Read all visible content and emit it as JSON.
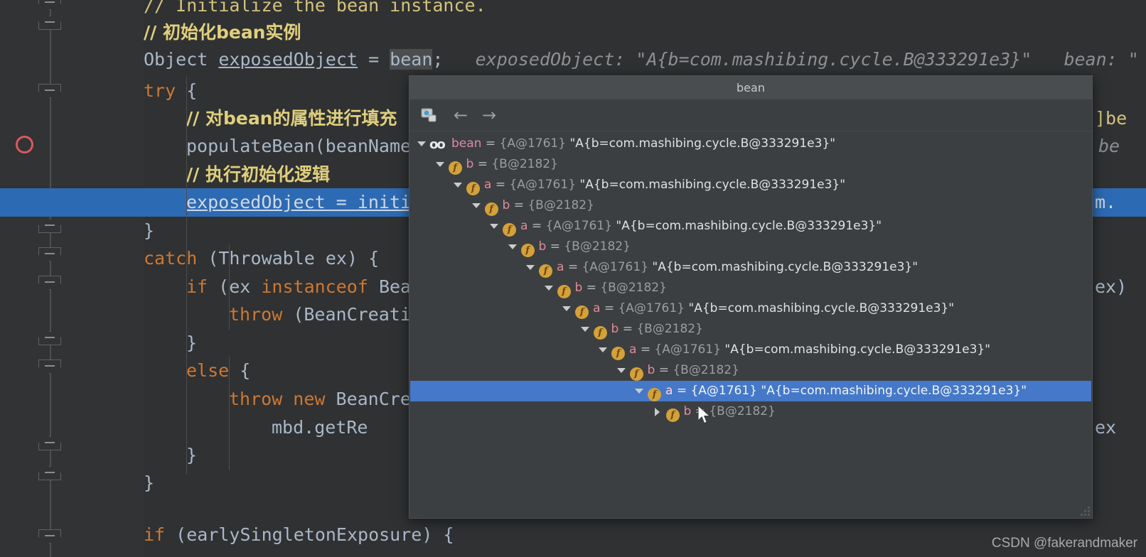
{
  "editor": {
    "lines": [
      {
        "indent": 0,
        "segments": [
          {
            "cls": "cm",
            "text": "// Initialize the bean instance."
          }
        ]
      },
      {
        "indent": 0,
        "segments": [
          {
            "cls": "cmcn",
            "text": "// 初始化bean实例"
          }
        ]
      },
      {
        "indent": 0,
        "segments": [
          {
            "cls": "pl",
            "text": "Object "
          },
          {
            "cls": "ident underl",
            "text": "exposedObject"
          },
          {
            "cls": "pl",
            "text": " = "
          },
          {
            "cls": "varhl",
            "text": "bean"
          },
          {
            "cls": "pl",
            "text": ";"
          },
          {
            "cls": "hintv",
            "text": "   exposedObject: \"A{b=com.mashibing.cycle.B@333291e3}\"   bean: \""
          }
        ]
      },
      {
        "indent": 0,
        "segments": [
          {
            "cls": "kw",
            "text": "try"
          },
          {
            "cls": "pl",
            "text": " {"
          }
        ]
      },
      {
        "indent": 1,
        "segments": [
          {
            "cls": "cmcn",
            "text": "// 对bean的属性进行填充"
          }
        ]
      },
      {
        "indent": 1,
        "segments": [
          {
            "cls": "pl",
            "text": "populateBean(beanName"
          }
        ]
      },
      {
        "indent": 1,
        "segments": [
          {
            "cls": "cmcn",
            "text": "// 执行初始化逻辑"
          }
        ]
      },
      {
        "indent": 0,
        "segments": [
          {
            "cls": "pl",
            "text": "}"
          }
        ]
      },
      {
        "indent": 0,
        "segments": [
          {
            "cls": "kw",
            "text": "catch"
          },
          {
            "cls": "pl",
            "text": " (Throwable ex) {"
          }
        ]
      },
      {
        "indent": 1,
        "segments": [
          {
            "cls": "kw",
            "text": "if"
          },
          {
            "cls": "pl",
            "text": " (ex "
          },
          {
            "cls": "kw",
            "text": "instanceof"
          },
          {
            "cls": "pl",
            "text": " Bea"
          }
        ]
      },
      {
        "indent": 2,
        "segments": [
          {
            "cls": "kw",
            "text": "throw"
          },
          {
            "cls": "pl",
            "text": " (BeanCreati"
          }
        ]
      },
      {
        "indent": 1,
        "segments": [
          {
            "cls": "pl",
            "text": "}"
          }
        ]
      },
      {
        "indent": 1,
        "segments": [
          {
            "cls": "kw",
            "text": "else"
          },
          {
            "cls": "pl",
            "text": " {"
          }
        ]
      },
      {
        "indent": 2,
        "segments": [
          {
            "cls": "kw",
            "text": "throw new"
          },
          {
            "cls": "pl",
            "text": " BeanCre"
          }
        ]
      },
      {
        "indent": 3,
        "segments": [
          {
            "cls": "pl",
            "text": "mbd.getRe"
          }
        ]
      },
      {
        "indent": 1,
        "segments": [
          {
            "cls": "pl",
            "text": "}"
          }
        ]
      },
      {
        "indent": 0,
        "segments": [
          {
            "cls": "pl",
            "text": "}"
          }
        ]
      },
      {
        "indent": 0,
        "segments": [
          {
            "cls": "kw",
            "text": "if"
          },
          {
            "cls": "pl",
            "text": " (earlySingletonExposure) {"
          }
        ]
      }
    ],
    "highlighted_line": "exposedObject = initi",
    "right_fragments": [
      {
        "text": "]be",
        "cls": "cm"
      },
      {
        "text": "be",
        "cls": "hintv"
      },
      {
        "text": "m.",
        "cls": "sel"
      },
      {
        "text": "ex)",
        "cls": "pl"
      },
      {
        "text": "ex",
        "cls": "pl"
      }
    ]
  },
  "popup": {
    "title": "bean",
    "toolbar": {
      "watch_icon": "copy-value-icon",
      "back_label": "←",
      "forward_label": "→"
    },
    "tree": [
      {
        "depth": 0,
        "icon": "watch",
        "arrow": "open",
        "selected": false,
        "name": "bean",
        "eq": " = ",
        "id": "{A@1761}",
        "value": "\"A{b=com.mashibing.cycle.B@333291e3}\""
      },
      {
        "depth": 1,
        "icon": "field",
        "arrow": "open",
        "selected": false,
        "name": "b",
        "eq": " = ",
        "id": "{B@2182}",
        "value": ""
      },
      {
        "depth": 2,
        "icon": "field",
        "arrow": "open",
        "selected": false,
        "name": "a",
        "eq": " = ",
        "id": "{A@1761}",
        "value": "\"A{b=com.mashibing.cycle.B@333291e3}\""
      },
      {
        "depth": 3,
        "icon": "field",
        "arrow": "open",
        "selected": false,
        "name": "b",
        "eq": " = ",
        "id": "{B@2182}",
        "value": ""
      },
      {
        "depth": 4,
        "icon": "field",
        "arrow": "open",
        "selected": false,
        "name": "a",
        "eq": " = ",
        "id": "{A@1761}",
        "value": "\"A{b=com.mashibing.cycle.B@333291e3}\""
      },
      {
        "depth": 5,
        "icon": "field",
        "arrow": "open",
        "selected": false,
        "name": "b",
        "eq": " = ",
        "id": "{B@2182}",
        "value": ""
      },
      {
        "depth": 6,
        "icon": "field",
        "arrow": "open",
        "selected": false,
        "name": "a",
        "eq": " = ",
        "id": "{A@1761}",
        "value": "\"A{b=com.mashibing.cycle.B@333291e3}\""
      },
      {
        "depth": 7,
        "icon": "field",
        "arrow": "open",
        "selected": false,
        "name": "b",
        "eq": " = ",
        "id": "{B@2182}",
        "value": ""
      },
      {
        "depth": 8,
        "icon": "field",
        "arrow": "open",
        "selected": false,
        "name": "a",
        "eq": " = ",
        "id": "{A@1761}",
        "value": "\"A{b=com.mashibing.cycle.B@333291e3}\""
      },
      {
        "depth": 9,
        "icon": "field",
        "arrow": "open",
        "selected": false,
        "name": "b",
        "eq": " = ",
        "id": "{B@2182}",
        "value": ""
      },
      {
        "depth": 10,
        "icon": "field",
        "arrow": "open",
        "selected": false,
        "name": "a",
        "eq": " = ",
        "id": "{A@1761}",
        "value": "\"A{b=com.mashibing.cycle.B@333291e3}\""
      },
      {
        "depth": 11,
        "icon": "field",
        "arrow": "open",
        "selected": false,
        "name": "b",
        "eq": " = ",
        "id": "{B@2182}",
        "value": ""
      },
      {
        "depth": 12,
        "icon": "field",
        "arrow": "open",
        "selected": true,
        "name": "a",
        "eq": " = ",
        "id": "{A@1761}",
        "value": "\"A{b=com.mashibing.cycle.B@333291e3}\""
      },
      {
        "depth": 13,
        "icon": "field",
        "arrow": "closed",
        "selected": false,
        "name": "b",
        "eq": " = ",
        "id": "{B@2182}",
        "value": ""
      }
    ]
  },
  "watermark": "CSDN @fakerandmaker",
  "colors": {
    "editor_bg": "#2f3133",
    "gutter_bg": "#313335",
    "popup_bg": "#3c3f41",
    "popup_title_bg": "#4a4d4f",
    "selection_blue": "#4578c8",
    "line_highlight_blue": "#2d6ab4",
    "keyword_orange": "#cc7832",
    "comment_yellow": "#d4c37a",
    "field_icon_orange": "#d4a13a",
    "var_name_pink": "#e08a9b",
    "breakpoint_red": "#db5860"
  }
}
